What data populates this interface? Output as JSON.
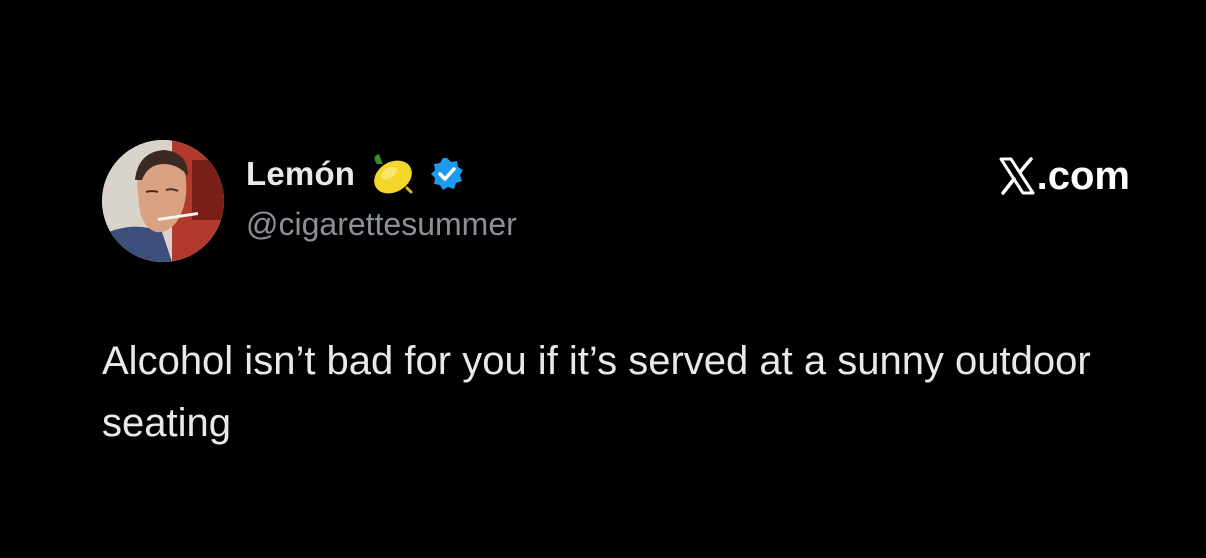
{
  "tweet": {
    "author": {
      "display_name": "Lemón",
      "handle": "@cigarettesummer",
      "name_emoji": "lemon-icon",
      "verified": true,
      "verified_color": "#1d9bf0"
    },
    "source": {
      "logo": "x-logo-icon",
      "text": ".com"
    },
    "text": "Alcohol isn’t bad for you if it’s served at a sunny outdoor seating"
  },
  "colors": {
    "background": "#000000",
    "primary_text": "#e7e9ea",
    "secondary_text": "#8b9096",
    "lemon_yellow": "#f5d62a"
  }
}
